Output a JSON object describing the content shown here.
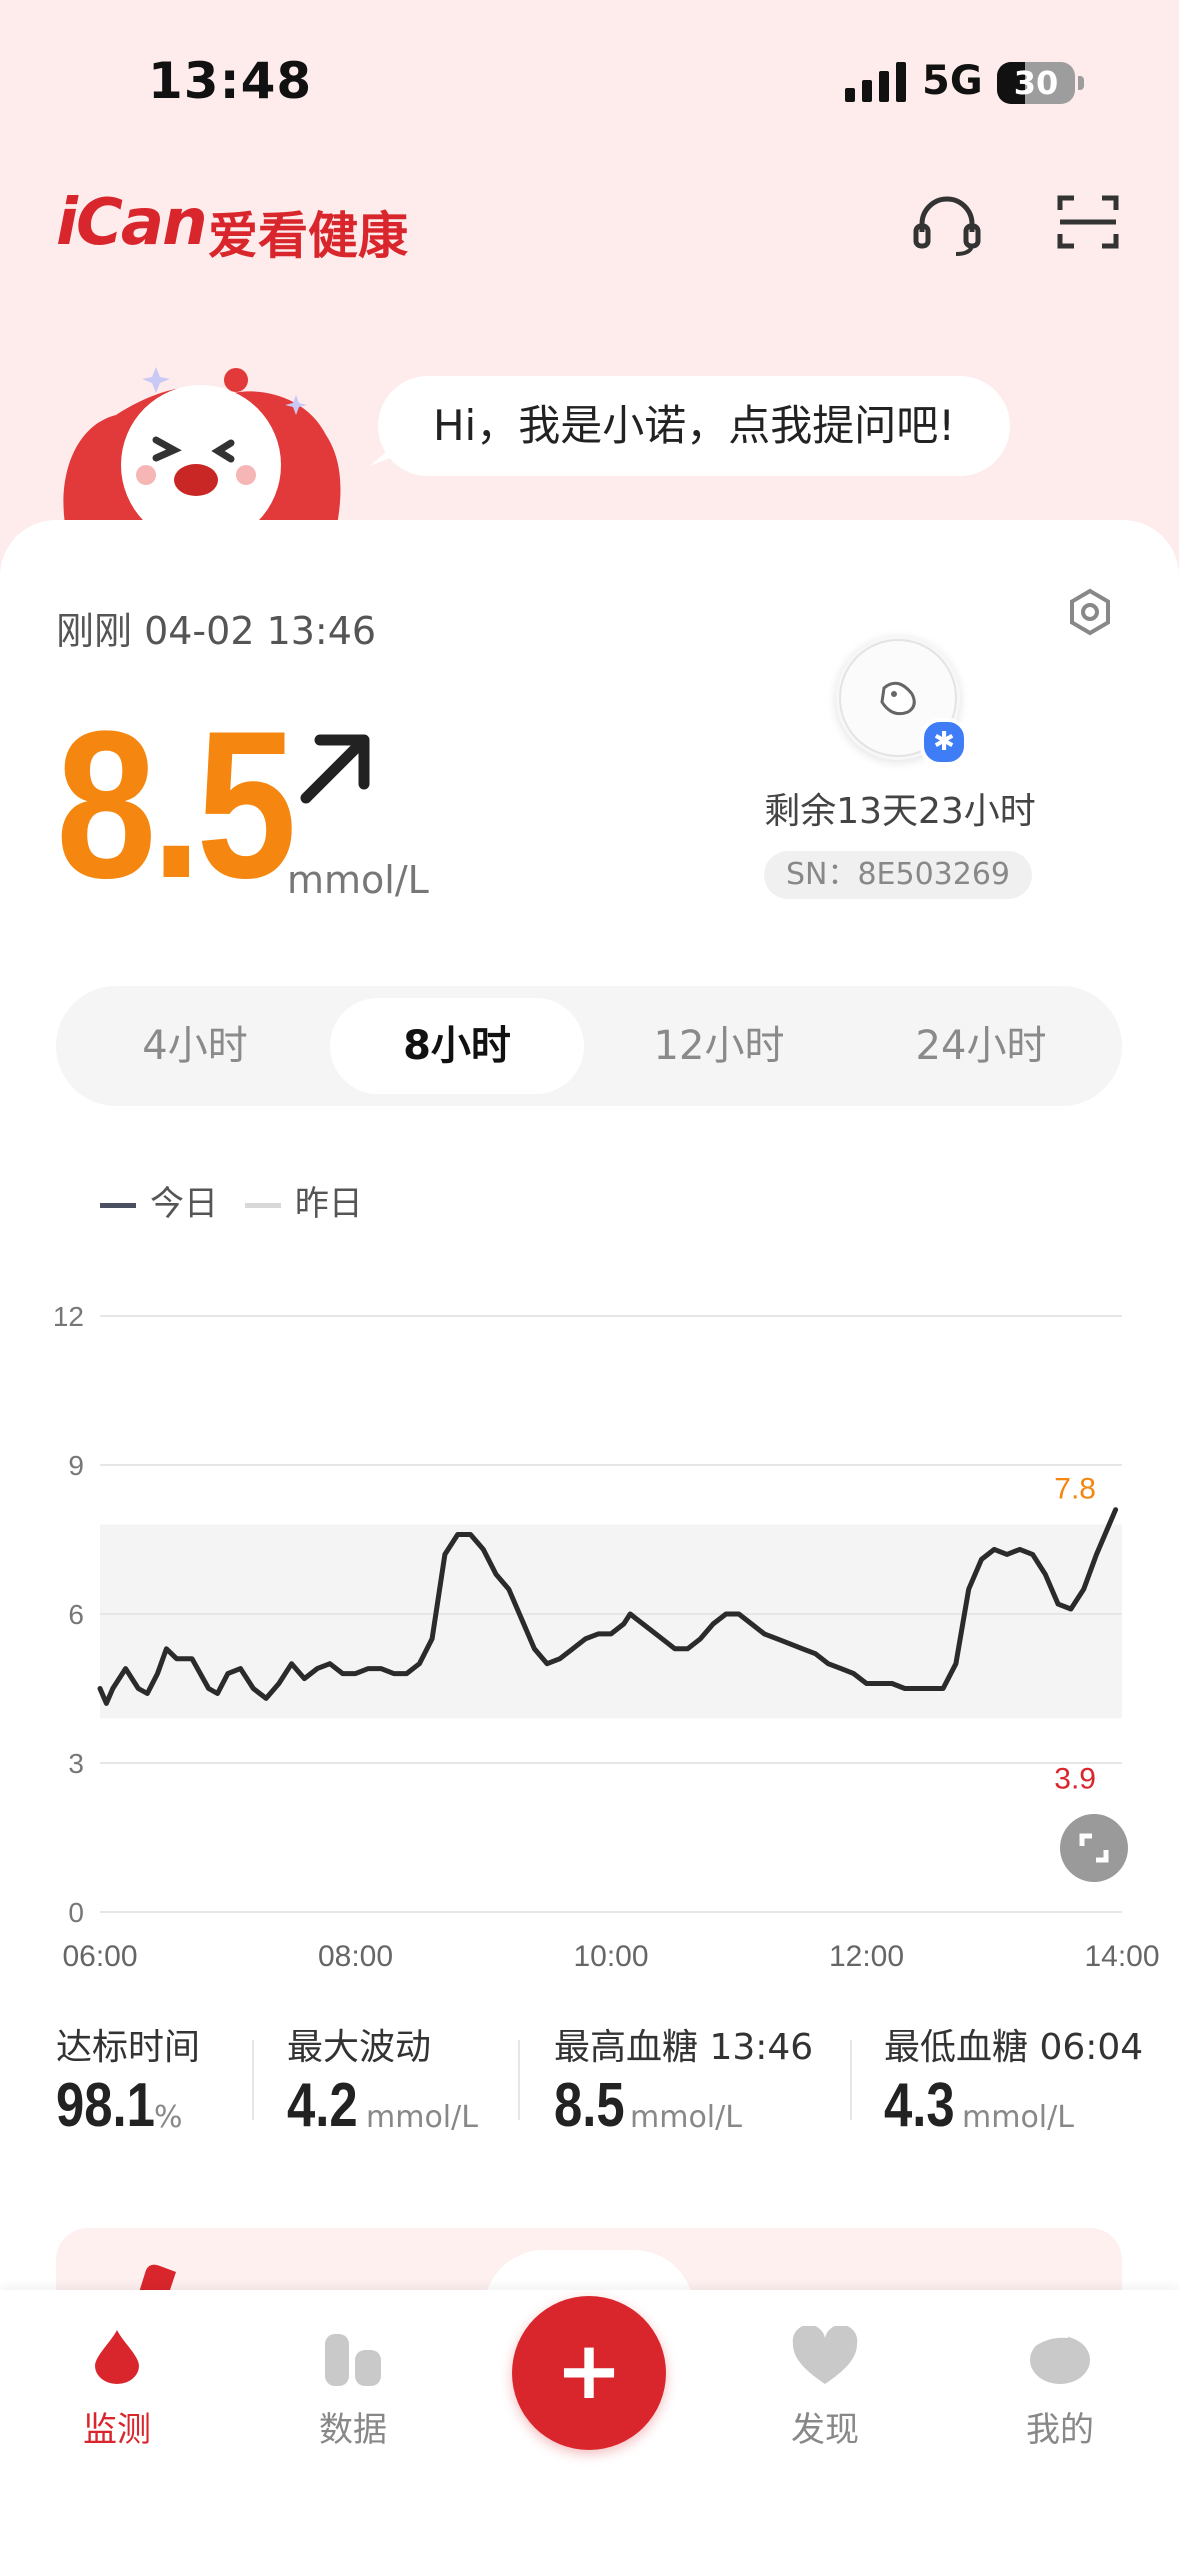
{
  "status_bar": {
    "time": "13:48",
    "network": "5G",
    "battery": "30"
  },
  "header": {
    "logo": "iCan",
    "logo_cn": "爱看健康",
    "icons": [
      "headset-icon",
      "scan-icon"
    ]
  },
  "assistant": {
    "bubble": "Hi，我是小诺，点我提问吧!"
  },
  "reading": {
    "timestamp": "刚刚 04-02 13:46",
    "value": "8.5",
    "unit": "mmol/L",
    "trend": "rising",
    "color": "#f5860f"
  },
  "sensor": {
    "remaining": "剩余13天23小时",
    "sn": "SN：8E503269"
  },
  "range_tabs": {
    "items": [
      "4小时",
      "8小时",
      "12小时",
      "24小时"
    ],
    "active": 1
  },
  "legend": [
    {
      "label": "今日",
      "color": "#4a5060"
    },
    {
      "label": "昨日",
      "color": "#d8d8d8"
    }
  ],
  "chart_data": {
    "type": "line",
    "x_ticks": [
      "06:00",
      "08:00",
      "10:00",
      "12:00",
      "14:00"
    ],
    "y_ticks": [
      "0",
      "3",
      "6",
      "9",
      "12"
    ],
    "ylim": [
      0,
      12
    ],
    "xlim_hours": [
      6,
      14
    ],
    "target_range": [
      3.9,
      7.8
    ],
    "target_labels": {
      "upper": "7.8",
      "lower": "3.9"
    },
    "series": [
      {
        "color": "#2b2b2b",
        "points": [
          [
            6.0,
            4.5
          ],
          [
            6.05,
            4.2
          ],
          [
            6.1,
            4.5
          ],
          [
            6.2,
            4.9
          ],
          [
            6.3,
            4.5
          ],
          [
            6.37,
            4.4
          ],
          [
            6.45,
            4.8
          ],
          [
            6.52,
            5.3
          ],
          [
            6.6,
            5.1
          ],
          [
            6.72,
            5.1
          ],
          [
            6.85,
            4.5
          ],
          [
            6.92,
            4.4
          ],
          [
            7.0,
            4.8
          ],
          [
            7.1,
            4.9
          ],
          [
            7.2,
            4.5
          ],
          [
            7.3,
            4.3
          ],
          [
            7.4,
            4.6
          ],
          [
            7.5,
            5.0
          ],
          [
            7.6,
            4.7
          ],
          [
            7.7,
            4.9
          ],
          [
            7.8,
            5.0
          ],
          [
            7.9,
            4.8
          ],
          [
            8.0,
            4.8
          ],
          [
            8.1,
            4.9
          ],
          [
            8.2,
            4.9
          ],
          [
            8.3,
            4.8
          ],
          [
            8.4,
            4.8
          ],
          [
            8.5,
            5.0
          ],
          [
            8.6,
            5.5
          ],
          [
            8.7,
            7.2
          ],
          [
            8.8,
            7.6
          ],
          [
            8.9,
            7.6
          ],
          [
            9.0,
            7.3
          ],
          [
            9.1,
            6.8
          ],
          [
            9.2,
            6.5
          ],
          [
            9.3,
            5.9
          ],
          [
            9.4,
            5.3
          ],
          [
            9.5,
            5.0
          ],
          [
            9.6,
            5.1
          ],
          [
            9.7,
            5.3
          ],
          [
            9.8,
            5.5
          ],
          [
            9.9,
            5.6
          ],
          [
            10.0,
            5.6
          ],
          [
            10.1,
            5.8
          ],
          [
            10.15,
            6.0
          ],
          [
            10.2,
            5.9
          ],
          [
            10.3,
            5.7
          ],
          [
            10.4,
            5.5
          ],
          [
            10.5,
            5.3
          ],
          [
            10.6,
            5.3
          ],
          [
            10.7,
            5.5
          ],
          [
            10.8,
            5.8
          ],
          [
            10.9,
            6.0
          ],
          [
            11.0,
            6.0
          ],
          [
            11.1,
            5.8
          ],
          [
            11.2,
            5.6
          ],
          [
            11.3,
            5.5
          ],
          [
            11.4,
            5.4
          ],
          [
            11.5,
            5.3
          ],
          [
            11.6,
            5.2
          ],
          [
            11.7,
            5.0
          ],
          [
            11.8,
            4.9
          ],
          [
            11.9,
            4.8
          ],
          [
            12.0,
            4.6
          ],
          [
            12.1,
            4.6
          ],
          [
            12.2,
            4.6
          ],
          [
            12.3,
            4.5
          ],
          [
            12.4,
            4.5
          ],
          [
            12.5,
            4.5
          ],
          [
            12.6,
            4.5
          ],
          [
            12.7,
            5.0
          ],
          [
            12.8,
            6.5
          ],
          [
            12.9,
            7.1
          ],
          [
            13.0,
            7.3
          ],
          [
            13.1,
            7.2
          ],
          [
            13.2,
            7.3
          ],
          [
            13.3,
            7.2
          ],
          [
            13.4,
            6.8
          ],
          [
            13.5,
            6.2
          ],
          [
            13.6,
            6.1
          ],
          [
            13.7,
            6.5
          ],
          [
            13.8,
            7.2
          ],
          [
            13.9,
            7.8
          ],
          [
            13.95,
            8.1
          ]
        ]
      }
    ]
  },
  "stats": [
    {
      "label": "达标时间",
      "value": "98.1",
      "unit": "%"
    },
    {
      "label": "最大波动",
      "value": "4.2",
      "unit": "mmol/L"
    },
    {
      "label": "最高血糖 13:46",
      "value": "8.5",
      "unit": "mmol/L"
    },
    {
      "label": "最低血糖 06:04",
      "value": "4.3",
      "unit": "mmol/L"
    }
  ],
  "nav": [
    {
      "label": "监测",
      "icon": "drop-icon",
      "active": true
    },
    {
      "label": "数据",
      "icon": "bars-icon",
      "active": false
    },
    {
      "label": "+",
      "icon": "plus-icon",
      "active": false
    },
    {
      "label": "发现",
      "icon": "heart-icon",
      "active": false
    },
    {
      "label": "我的",
      "icon": "profile-icon",
      "active": false
    }
  ],
  "colors": {
    "brand": "#d9262c",
    "accent": "#f5860f",
    "low": "#d9262c"
  }
}
